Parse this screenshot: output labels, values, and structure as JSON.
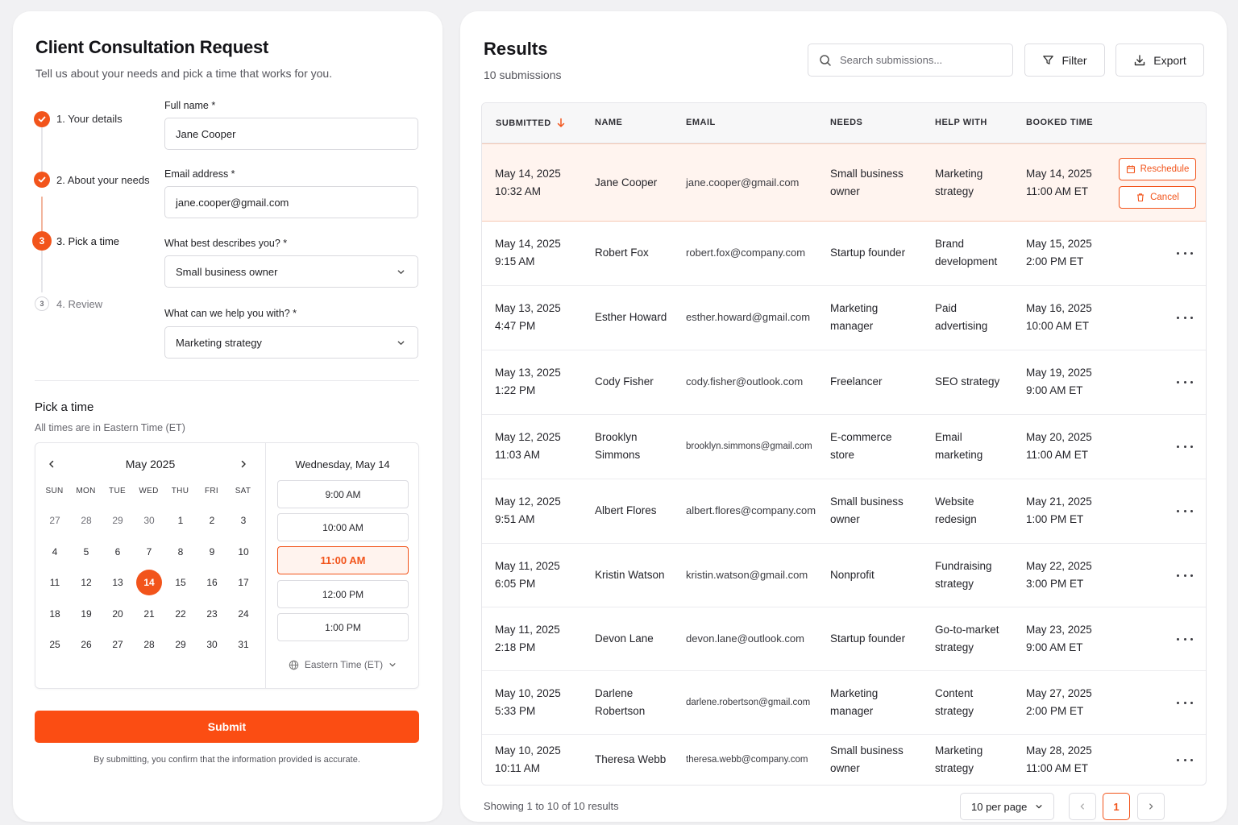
{
  "colors": {
    "accent": "#f2541b",
    "accent_bg": "#fff4ef",
    "text": "#1f1f23",
    "muted": "#66666d"
  },
  "form": {
    "title": "Client Consultation Request",
    "subtitle": "Tell us about your needs and pick a time that works for you.",
    "steps": [
      {
        "label": "1.  Your details",
        "state": "done"
      },
      {
        "label": "2.  About your needs",
        "state": "done"
      },
      {
        "number": "3",
        "label": "3. Pick a time",
        "state": "active"
      },
      {
        "number": "3",
        "label": "4. Review",
        "state": "todo"
      }
    ],
    "fields": {
      "full_name": {
        "label": "Full name *",
        "value": "Jane Cooper"
      },
      "email": {
        "label": "Email address *",
        "value": "jane.cooper@gmail.com"
      },
      "describe": {
        "label": "What best describes you? *",
        "value": "Small business owner"
      },
      "help": {
        "label": "What can we help you with? *",
        "value": "Marketing strategy"
      }
    },
    "pick_time": {
      "title": "Pick a time",
      "subtitle": "All times are in Eastern Time (ET)",
      "month": "May 2025",
      "weekdays": [
        "SUN",
        "MON",
        "TUE",
        "WED",
        "THU",
        "FRI",
        "SAT"
      ],
      "weeks": [
        [
          "27",
          "28",
          "29",
          "30",
          "1",
          "2",
          "3"
        ],
        [
          "4",
          "5",
          "6",
          "7",
          "8",
          "9",
          "10"
        ],
        [
          "11",
          "12",
          "13",
          "14",
          "15",
          "16",
          "17"
        ],
        [
          "18",
          "19",
          "20",
          "21",
          "22",
          "23",
          "24"
        ],
        [
          "25",
          "26",
          "27",
          "28",
          "29",
          "30",
          "31"
        ]
      ],
      "selected_day": "14",
      "day_heading": "Wednesday, May 14",
      "slots": [
        "9:00 AM",
        "10:00 AM",
        "11:00 AM",
        "12:00 PM",
        "1:00 PM"
      ],
      "selected_slot": "11:00 AM",
      "timezone": "Eastern Time (ET)"
    },
    "submit_label": "Submit",
    "disclaimer": "By submitting, you confirm that the information provided is accurate."
  },
  "results": {
    "title": "Results",
    "count_text": "10 submissions",
    "search_placeholder": "Search submissions...",
    "filter_label": "Filter",
    "export_label": "Export",
    "columns": [
      "SUBMITTED",
      "NAME",
      "EMAIL",
      "NEEDS",
      "HELP WITH",
      "BOOKED TIME"
    ],
    "rows": [
      {
        "date": "May 14, 2025",
        "time": "10:32 AM",
        "name": [
          "Jane Cooper"
        ],
        "email": "jane.cooper@gmail.com",
        "needs": [
          "Small business",
          "owner"
        ],
        "help": [
          "Marketing",
          "strategy"
        ],
        "booked_date": "May 14, 2025",
        "booked_time": "11:00 AM ET",
        "highlight": true
      },
      {
        "date": "May 14, 2025",
        "time": "9:15 AM",
        "name": [
          "Robert Fox"
        ],
        "email": "robert.fox@company.com",
        "needs": [
          "Startup founder"
        ],
        "help": [
          "Brand",
          "development"
        ],
        "booked_date": "May 15, 2025",
        "booked_time": "2:00 PM ET"
      },
      {
        "date": "May 13, 2025",
        "time": "4:47 PM",
        "name": [
          "Esther Howard"
        ],
        "email": "esther.howard@gmail.com",
        "needs": [
          "Marketing",
          "manager"
        ],
        "help": [
          "Paid",
          "advertising"
        ],
        "booked_date": "May 16, 2025",
        "booked_time": "10:00 AM ET"
      },
      {
        "date": "May 13, 2025",
        "time": "1:22 PM",
        "name": [
          "Cody Fisher"
        ],
        "email": "cody.fisher@outlook.com",
        "needs": [
          "Freelancer"
        ],
        "help": [
          "SEO strategy"
        ],
        "booked_date": "May 19, 2025",
        "booked_time": "9:00 AM ET"
      },
      {
        "date": "May 12, 2025",
        "time": "11:03 AM",
        "name": [
          "Brooklyn",
          "Simmons"
        ],
        "email": "brooklyn.simmons@gmail.com",
        "email_small": true,
        "needs": [
          "E-commerce",
          "store"
        ],
        "help": [
          "Email",
          "marketing"
        ],
        "booked_date": "May 20, 2025",
        "booked_time": "11:00 AM ET"
      },
      {
        "date": "May 12, 2025",
        "time": "9:51 AM",
        "name": [
          "Albert Flores"
        ],
        "email": "albert.flores@company.com",
        "needs": [
          "Small business",
          "owner"
        ],
        "help": [
          "Website",
          "redesign"
        ],
        "booked_date": "May 21, 2025",
        "booked_time": "1:00 PM ET"
      },
      {
        "date": "May 11, 2025",
        "time": "6:05 PM",
        "name": [
          "Kristin Watson"
        ],
        "email": "kristin.watson@gmail.com",
        "needs": [
          "Nonprofit"
        ],
        "help": [
          "Fundraising",
          "strategy"
        ],
        "booked_date": "May 22, 2025",
        "booked_time": "3:00 PM ET"
      },
      {
        "date": "May 11, 2025",
        "time": "2:18 PM",
        "name": [
          "Devon Lane"
        ],
        "email": "devon.lane@outlook.com",
        "needs": [
          "Startup founder"
        ],
        "help": [
          "Go-to-market",
          "strategy"
        ],
        "booked_date": "May 23, 2025",
        "booked_time": "9:00 AM ET"
      },
      {
        "date": "May 10, 2025",
        "time": "5:33 PM",
        "name": [
          "Darlene",
          "Robertson"
        ],
        "email": "darlene.robertson@gmail.com",
        "email_small": true,
        "needs": [
          "Marketing",
          "manager"
        ],
        "help": [
          "Content",
          "strategy"
        ],
        "booked_date": "May 27, 2025",
        "booked_time": "2:00 PM ET"
      },
      {
        "date": "May 10, 2025",
        "time": "10:11 AM",
        "name": [
          "Theresa Webb"
        ],
        "email": "theresa.webb@company.com",
        "email_small": true,
        "needs": [
          "Small business",
          "owner"
        ],
        "help": [
          "Marketing",
          "strategy"
        ],
        "booked_date": "May 28, 2025",
        "booked_time": "11:00 AM ET"
      }
    ],
    "reschedule_label": "Reschedule",
    "cancel_label": "Cancel",
    "showing_text": "Showing 1 to 10 of 10 results",
    "per_page": "10 per page",
    "current_page": "1"
  }
}
